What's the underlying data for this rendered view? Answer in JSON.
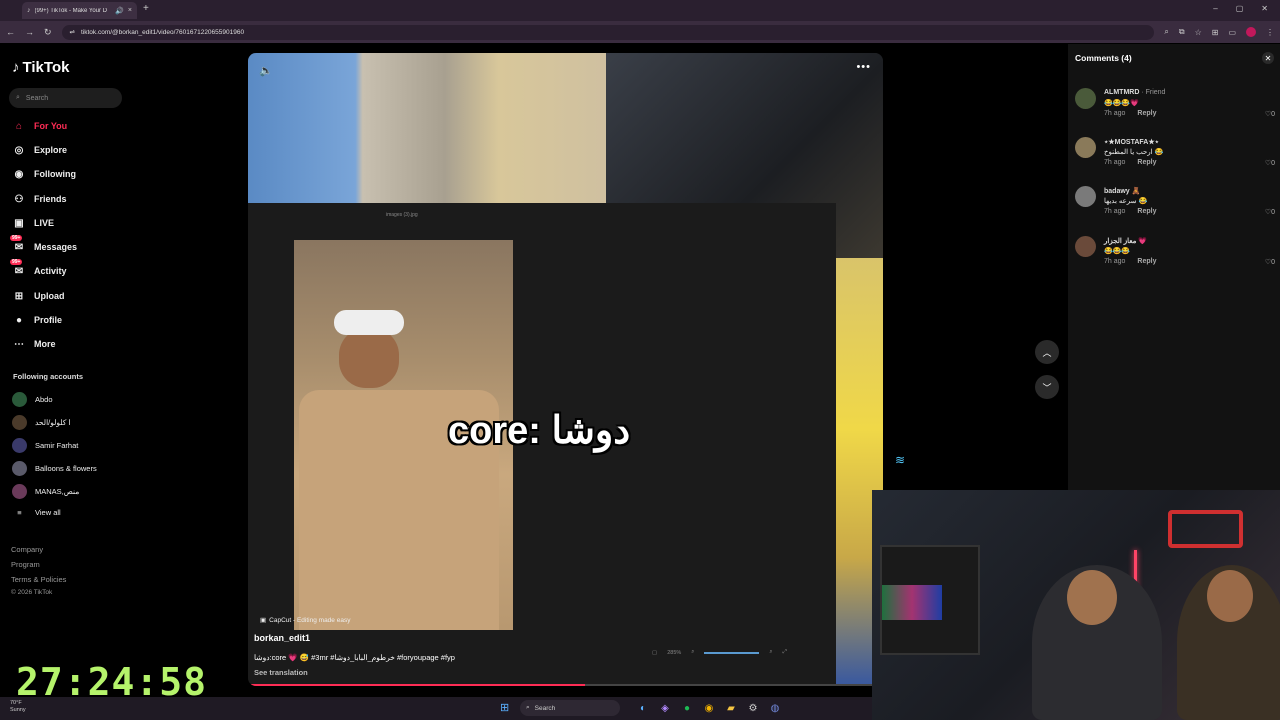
{
  "browser": {
    "tab_title": "(99+) TikTok - Make Your D",
    "url": "tiktok.com/@borkan_edit1/video/7601671220655901960",
    "new_tab": "+",
    "tab_close": "×",
    "window_controls": [
      "–",
      "▢",
      "✕"
    ]
  },
  "sidebar": {
    "brand": "TikTok",
    "search_placeholder": "Search",
    "items": [
      {
        "label": "For You",
        "icon": "home-icon"
      },
      {
        "label": "Explore",
        "icon": "compass-icon"
      },
      {
        "label": "Following",
        "icon": "following-icon"
      },
      {
        "label": "Friends",
        "icon": "friends-icon"
      },
      {
        "label": "LIVE",
        "icon": "live-icon"
      },
      {
        "label": "Messages",
        "icon": "messages-icon",
        "badge": "99+"
      },
      {
        "label": "Activity",
        "icon": "activity-icon",
        "badge": "99+"
      },
      {
        "label": "Upload",
        "icon": "upload-icon"
      },
      {
        "label": "Profile",
        "icon": "profile-icon"
      },
      {
        "label": "More",
        "icon": "more-icon"
      }
    ],
    "following_title": "Following accounts",
    "following": [
      {
        "name": "Abdo"
      },
      {
        "name": "ا كلولو/الحد"
      },
      {
        "name": "Samir Farhat"
      },
      {
        "name": "Balloons & flowers"
      },
      {
        "name": "MANAS,منص"
      }
    ],
    "view_all": "View all",
    "footer": [
      "Company",
      "Program",
      "Terms & Policies",
      "© 2026 TikTok"
    ]
  },
  "timer": "27:24:58",
  "video": {
    "image_label": "images (3).jpg",
    "caption": "core: دوشا",
    "capcut": "CapCut - Editing made easy",
    "author": "borkan_edit1",
    "description": "دوشا:core 💗 😅 #3mr #خرطوم_البابا_دوشا #foryoupage #fyp",
    "see_translation": "See translation",
    "zoom_level": "285%",
    "progress": 0.53,
    "accent_color": "#fe2c55"
  },
  "comments": {
    "title": "Comments (4)",
    "items": [
      {
        "name": "ALMTMRD",
        "relation": " · Friend",
        "text": "😂😂😂💗",
        "time": "7h ago",
        "reply": "Reply",
        "likes": "0"
      },
      {
        "name": "⋆★MOSTAFA★⋆",
        "relation": "",
        "text": "ارحب يا المطنوخ 😂",
        "time": "7h ago",
        "reply": "Reply",
        "likes": "0"
      },
      {
        "name": "badawy 🧸",
        "relation": "",
        "text": "سرعه بديها 😂",
        "time": "7h ago",
        "reply": "Reply",
        "likes": "0"
      },
      {
        "name": "معاز الجزار 💗",
        "relation": "",
        "text": "😂😂😂",
        "time": "7h ago",
        "reply": "Reply",
        "likes": "0"
      }
    ]
  },
  "taskbar": {
    "weather_temp": "70°F",
    "weather_cond": "Sunny",
    "search_label": "Search"
  }
}
